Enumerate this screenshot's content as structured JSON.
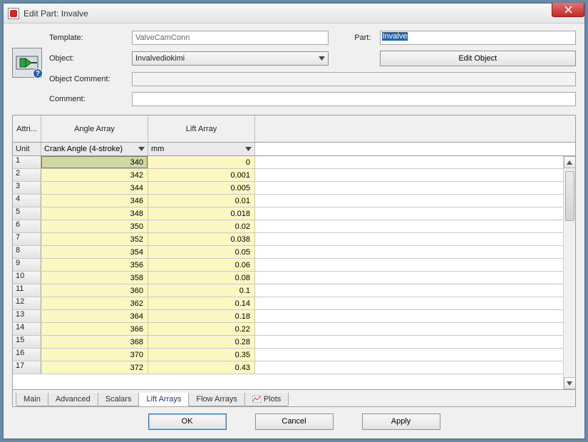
{
  "window": {
    "title": "Edit Part: Invalve"
  },
  "form": {
    "template_label": "Template:",
    "template_value": "ValveCamConn",
    "part_label": "Part:",
    "part_value": "Invalve",
    "object_label": "Object:",
    "object_value": "Invalvediokimi",
    "edit_object_label": "Edit Object",
    "object_comment_label": "Object Comment:",
    "comment_label": "Comment:"
  },
  "grid": {
    "attri_label": "Attri...",
    "unit_label": "Unit",
    "columns": [
      {
        "name": "Angle Array",
        "unit": "Crank Angle (4-stroke)"
      },
      {
        "name": "Lift Array",
        "unit": "mm"
      }
    ],
    "rows": [
      {
        "n": "1",
        "angle": "340",
        "lift": "0"
      },
      {
        "n": "2",
        "angle": "342",
        "lift": "0.001"
      },
      {
        "n": "3",
        "angle": "344",
        "lift": "0.005"
      },
      {
        "n": "4",
        "angle": "346",
        "lift": "0.01"
      },
      {
        "n": "5",
        "angle": "348",
        "lift": "0.018"
      },
      {
        "n": "6",
        "angle": "350",
        "lift": "0.02"
      },
      {
        "n": "7",
        "angle": "352",
        "lift": "0.038"
      },
      {
        "n": "8",
        "angle": "354",
        "lift": "0.05"
      },
      {
        "n": "9",
        "angle": "356",
        "lift": "0.06"
      },
      {
        "n": "10",
        "angle": "358",
        "lift": "0.08"
      },
      {
        "n": "11",
        "angle": "360",
        "lift": "0.1"
      },
      {
        "n": "12",
        "angle": "362",
        "lift": "0.14"
      },
      {
        "n": "13",
        "angle": "364",
        "lift": "0.18"
      },
      {
        "n": "14",
        "angle": "366",
        "lift": "0.22"
      },
      {
        "n": "15",
        "angle": "368",
        "lift": "0.28"
      },
      {
        "n": "16",
        "angle": "370",
        "lift": "0.35"
      },
      {
        "n": "17",
        "angle": "372",
        "lift": "0.43"
      }
    ]
  },
  "tabs": {
    "main": "Main",
    "advanced": "Advanced",
    "scalars": "Scalars",
    "lift_arrays": "Lift Arrays",
    "flow_arrays": "Flow Arrays",
    "plots": "Plots"
  },
  "footer": {
    "ok": "OK",
    "cancel": "Cancel",
    "apply": "Apply"
  },
  "chart_data": {
    "type": "table",
    "title": "Lift Arrays",
    "columns": [
      "Crank Angle (4-stroke)",
      "Lift (mm)"
    ],
    "x": [
      340,
      342,
      344,
      346,
      348,
      350,
      352,
      354,
      356,
      358,
      360,
      362,
      364,
      366,
      368,
      370,
      372
    ],
    "y": [
      0,
      0.001,
      0.005,
      0.01,
      0.018,
      0.02,
      0.038,
      0.05,
      0.06,
      0.08,
      0.1,
      0.14,
      0.18,
      0.22,
      0.28,
      0.35,
      0.43
    ]
  }
}
